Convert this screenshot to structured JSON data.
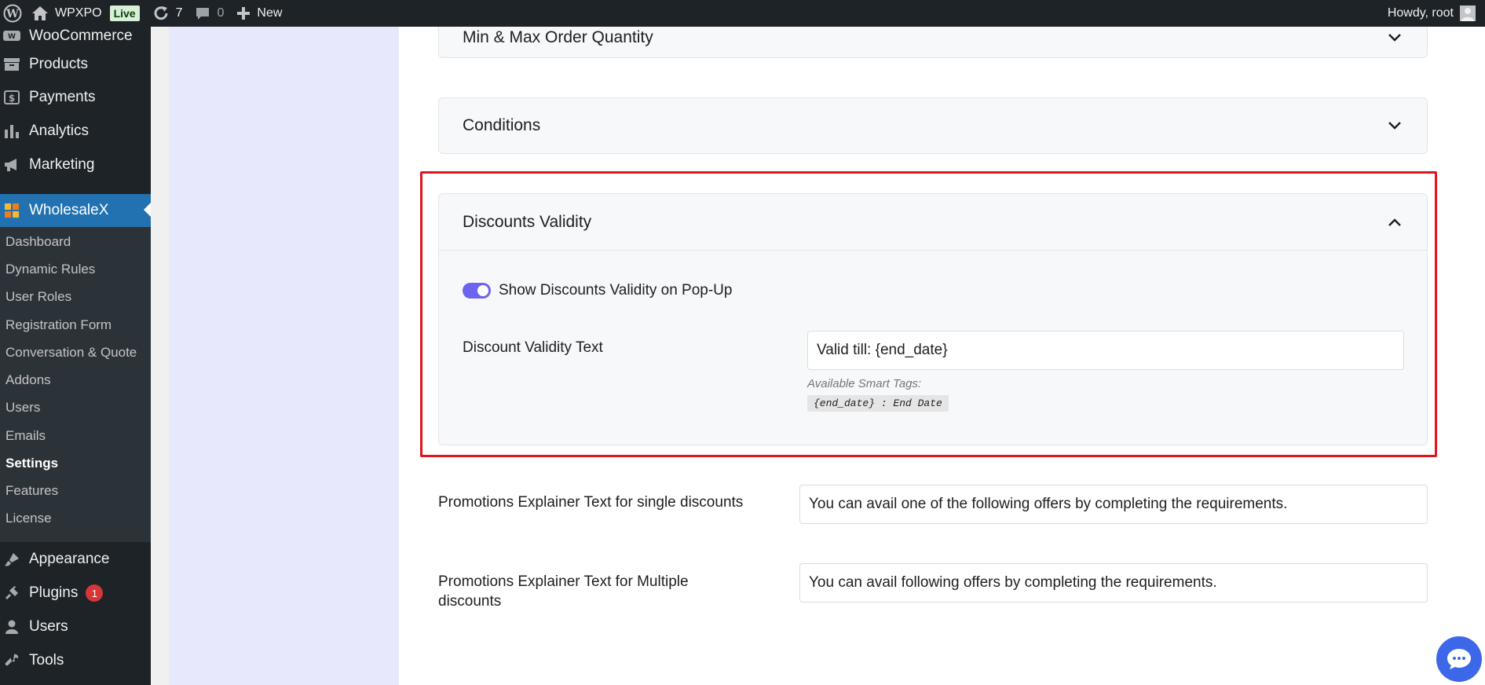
{
  "admin_bar": {
    "site_name": "WPXPO",
    "live_badge": "Live",
    "updates_count": "7",
    "comments_count": "0",
    "new_label": "New",
    "greeting": "Howdy, root"
  },
  "sidebar": {
    "top_items": [
      {
        "label": "WooCommerce",
        "icon": "woo-icon"
      },
      {
        "label": "Products",
        "icon": "archive-icon"
      },
      {
        "label": "Payments",
        "icon": "dollar-icon"
      },
      {
        "label": "Analytics",
        "icon": "bar-chart-icon"
      },
      {
        "label": "Marketing",
        "icon": "megaphone-icon"
      },
      {
        "label": "WholesaleX",
        "icon": "wholesalex-logo-icon"
      }
    ],
    "submenu": [
      "Dashboard",
      "Dynamic Rules",
      "User Roles",
      "Registration Form",
      "Conversation & Quote",
      "Addons",
      "Users",
      "Emails",
      "Settings",
      "Features",
      "License"
    ],
    "bottom_items": [
      {
        "label": "Appearance",
        "icon": "paintbrush-icon"
      },
      {
        "label": "Plugins",
        "icon": "plug-icon",
        "badge": "1"
      },
      {
        "label": "Users",
        "icon": "user-icon"
      },
      {
        "label": "Tools",
        "icon": "wrench-icon"
      }
    ]
  },
  "sections": {
    "min_max": "Min & Max Order Quantity",
    "conditions": "Conditions",
    "discounts_validity": {
      "title": "Discounts Validity",
      "toggle_label": "Show Discounts Validity on Pop-Up",
      "toggle_on": true,
      "field_label": "Discount Validity Text",
      "field_value": "Valid till: {end_date}",
      "smart_tags_label": "Available Smart Tags:",
      "smart_tag": "{end_date} : End Date"
    }
  },
  "promotions": {
    "single_label": "Promotions Explainer Text for single discounts",
    "single_value": "You can avail one of the following offers by completing the requirements.",
    "multiple_label": "Promotions Explainer Text for Multiple discounts",
    "multiple_value": "You can avail following offers by completing the requirements."
  },
  "colors": {
    "highlight": "#e0141e",
    "toggle": "#6c63f0",
    "active_menu": "#2271b1",
    "chat": "#3b67e8"
  }
}
